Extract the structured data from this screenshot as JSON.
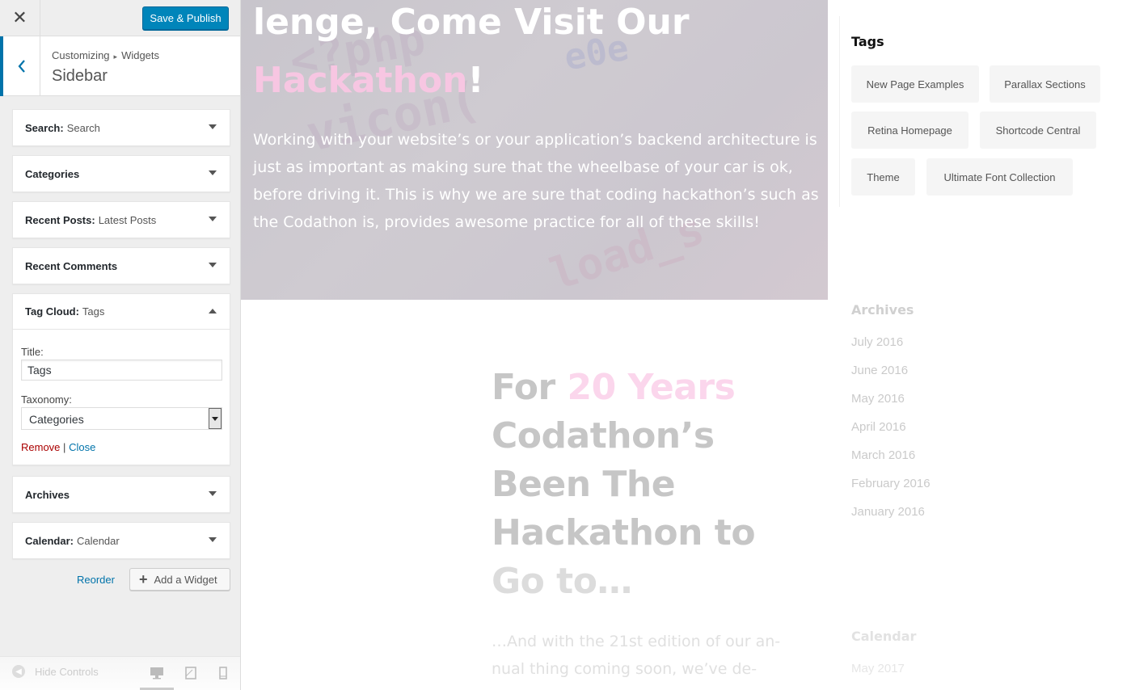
{
  "topbar": {
    "close_glyph": "✕",
    "publish_label": "Save & Publish"
  },
  "header": {
    "back_glyph": "‹",
    "breadcrumb": [
      "Customizing",
      "Widgets"
    ],
    "breadcrumb_sep": "▸",
    "title": "Sidebar"
  },
  "widgets": [
    {
      "name": "Search:",
      "sub": "Search",
      "expanded": false
    },
    {
      "name": "Categories",
      "sub": "",
      "expanded": false
    },
    {
      "name": "Recent Posts:",
      "sub": "Latest Posts",
      "expanded": false
    },
    {
      "name": "Recent Comments",
      "sub": "",
      "expanded": false
    },
    {
      "name": "Tag Cloud:",
      "sub": "Tags",
      "expanded": true
    },
    {
      "name": "Archives",
      "sub": "",
      "expanded": false
    },
    {
      "name": "Calendar:",
      "sub": "Calendar",
      "expanded": false
    }
  ],
  "tag_widget_form": {
    "title_label": "Title:",
    "title_value": "Tags",
    "taxonomy_label": "Taxonomy:",
    "taxonomy_selected": "Categories",
    "remove_label": "Remove",
    "separator": "|",
    "close_label": "Close"
  },
  "actions": {
    "reorder_label": "Reorder",
    "add_widget_label": "Add a Widget"
  },
  "footer": {
    "hide_controls_label": "Hide Controls",
    "devices": [
      "desktop-icon",
      "tablet-icon",
      "mobile-icon"
    ],
    "active_device": "desktop"
  },
  "preview": {
    "hero_heading_line1": "lenge, Come Visit Our",
    "hero_heading_pink": "Hackathon",
    "hero_heading_end": "!",
    "hero_text": "Working with your website’s or your application’s backend architecture is just as important as making sure that the wheelbase of your car is ok, before driving it. This is why we are sure that coding hackathon’s such as the Codathon is, provides awesome practice for all of these skills!",
    "big_heading_a": "For",
    "big_heading_pink": "20 Years",
    "big_heading_b": "Codathon’s Been The Hackathon to",
    "big_heading_c": "Go to…",
    "intro_text": "…And with the 21st edition of our an­nual thing coming soon, we’ve de-",
    "tags_title": "Tags",
    "tags": [
      "New Page Examples",
      "Parallax Sections",
      "Retina Homepage",
      "Shortcode Central",
      "Theme",
      "Ultimate Font Collection"
    ],
    "archives_title": "Archives",
    "archives": [
      "July 2016",
      "June 2016",
      "May 2016",
      "April 2016",
      "March 2016",
      "February 2016",
      "January 2016"
    ],
    "calendar_title": "Calendar",
    "calendar_month": "May 2017"
  },
  "colors": {
    "accent": "#0085ba",
    "link": "#0073aa",
    "remove": "#aa0000",
    "pink": "#f7c6e2"
  }
}
